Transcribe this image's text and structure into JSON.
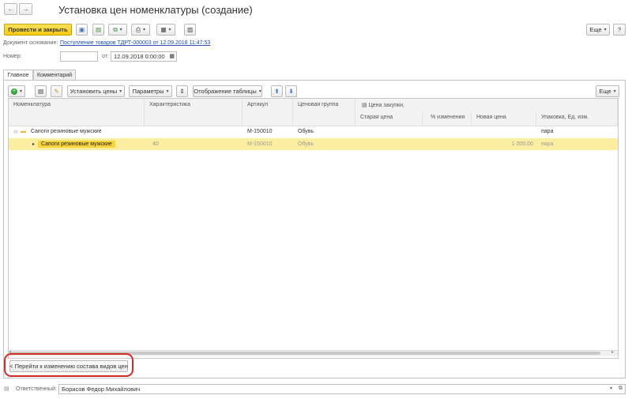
{
  "window": {
    "title": "Установка цен номенклатуры (создание)",
    "back_icon": "←",
    "forward_icon": "→",
    "more_label": "Еще",
    "help_label": "?"
  },
  "toolbar": {
    "post_close_label": "Провести и закрыть",
    "more_label": "Еще"
  },
  "header": {
    "base_doc_label": "Документ основание:",
    "base_doc_link": "Поступление товаров ТДРТ-000003 от 12.09.2018 11:47:53",
    "number_label": "Номер:",
    "number_value": "",
    "date_label": "от:",
    "date_value": "12.09.2018  0:00:00"
  },
  "tabs": [
    {
      "label": "Главное"
    },
    {
      "label": "Комментарий"
    }
  ],
  "table_toolbar": {
    "set_prices_label": "Установить цены",
    "params_label": "Параметры",
    "display_label": "Отображение таблицы",
    "more_label": "Еще"
  },
  "table": {
    "columns": {
      "item": "Номенклатура",
      "characteristic": "Характеристика",
      "article": "Артикул",
      "price_group": "Ценовая группа",
      "purchase_price": "Цена закупки,",
      "old_price": "Старая цена",
      "pct_change": "% изменения",
      "new_price": "Новая цена",
      "package": "Упаковка, Ед. изм."
    },
    "rows": [
      {
        "item": "Сапоги резиновые мужские",
        "characteristic": "",
        "article": "М-150010",
        "price_group": "Обувь",
        "old_price": "",
        "pct_change": "",
        "new_price": "",
        "package": "пара"
      },
      {
        "item": "Сапоги резиновые мужские",
        "characteristic": "40",
        "article": "М-150010",
        "price_group": "Обувь",
        "old_price": "",
        "pct_change": "",
        "new_price": "1 000,00",
        "package": "пара"
      }
    ]
  },
  "bottom": {
    "go_to_change_label": "< Перейти к изменению состава видов цен"
  },
  "footer": {
    "responsible_label": "Ответственный:",
    "responsible_value": "Борисов Федор Михайлович"
  },
  "colors": {
    "primary_button": "#f5c912",
    "selected_row": "#fbeea0",
    "highlight_ring": "#d62a2a",
    "link": "#1f4da8"
  }
}
